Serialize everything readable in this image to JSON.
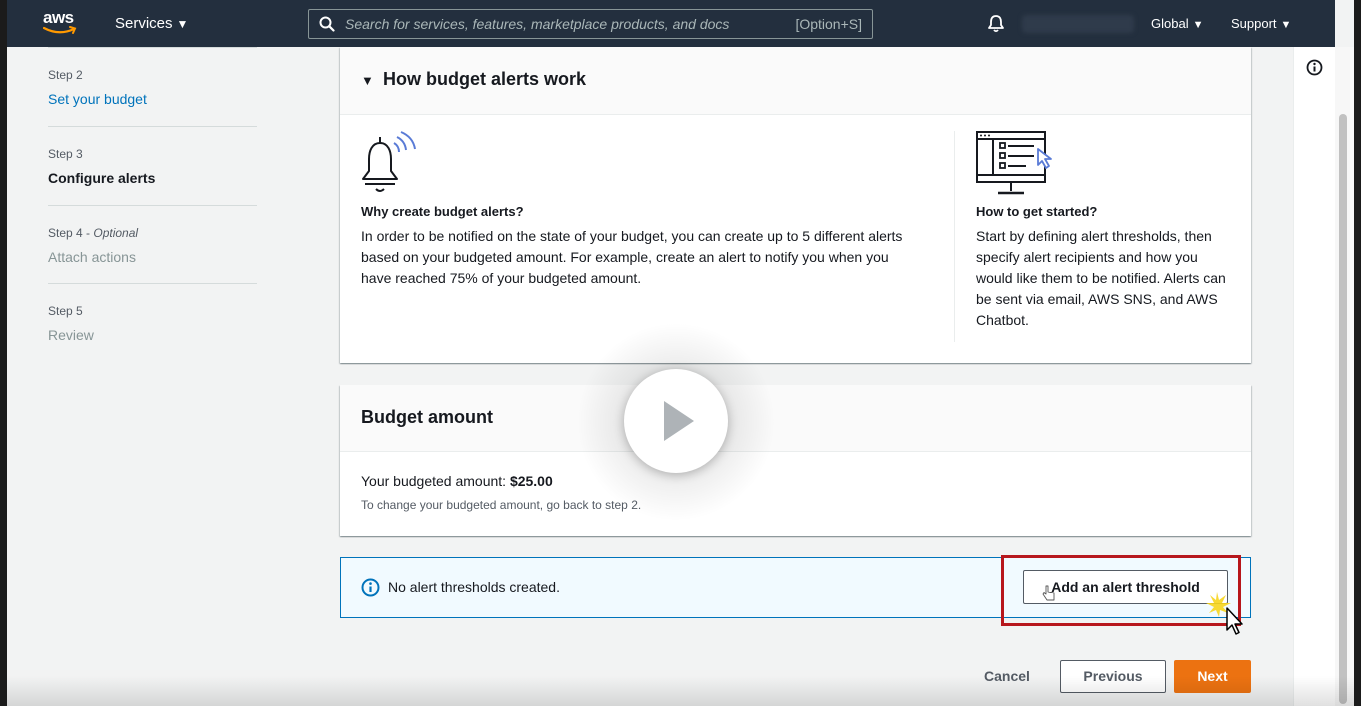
{
  "nav": {
    "logo": "aws",
    "services": "Services",
    "search_placeholder": "Search for services, features, marketplace products, and docs",
    "search_shortcut": "[Option+S]",
    "region": "Global",
    "support": "Support"
  },
  "steps": [
    {
      "label": "Step 2",
      "title": "Set your budget",
      "state": "link"
    },
    {
      "label": "Step 3",
      "title": "Configure alerts",
      "state": "current"
    },
    {
      "label": "Step 4",
      "optional": "Optional",
      "title": "Attach actions",
      "state": "disabled"
    },
    {
      "label": "Step 5",
      "title": "Review",
      "state": "disabled"
    }
  ],
  "how": {
    "title": "How budget alerts work",
    "why_title": "Why create budget alerts?",
    "why_body": "In order to be notified on the state of your budget, you can create up to 5 different alerts based on your budgeted amount. For example, create an alert to notify you when you have reached 75% of your budgeted amount.",
    "start_title": "How to get started?",
    "start_body": "Start by defining alert thresholds, then specify alert recipients and how you would like them to be notified. Alerts can be sent via email, AWS SNS, and AWS Chatbot."
  },
  "budget": {
    "title": "Budget amount",
    "label": "Your budgeted amount:",
    "amount": "$25.00",
    "hint": "To change your budgeted amount, go back to step 2."
  },
  "alerts": {
    "message": "No alert thresholds created.",
    "add_button": "Add an alert threshold"
  },
  "footer": {
    "cancel": "Cancel",
    "previous": "Previous",
    "next": "Next"
  },
  "colors": {
    "nav_bg": "#232f3e",
    "link": "#0073bb",
    "primary": "#ec7211",
    "highlight": "#b7171d"
  }
}
